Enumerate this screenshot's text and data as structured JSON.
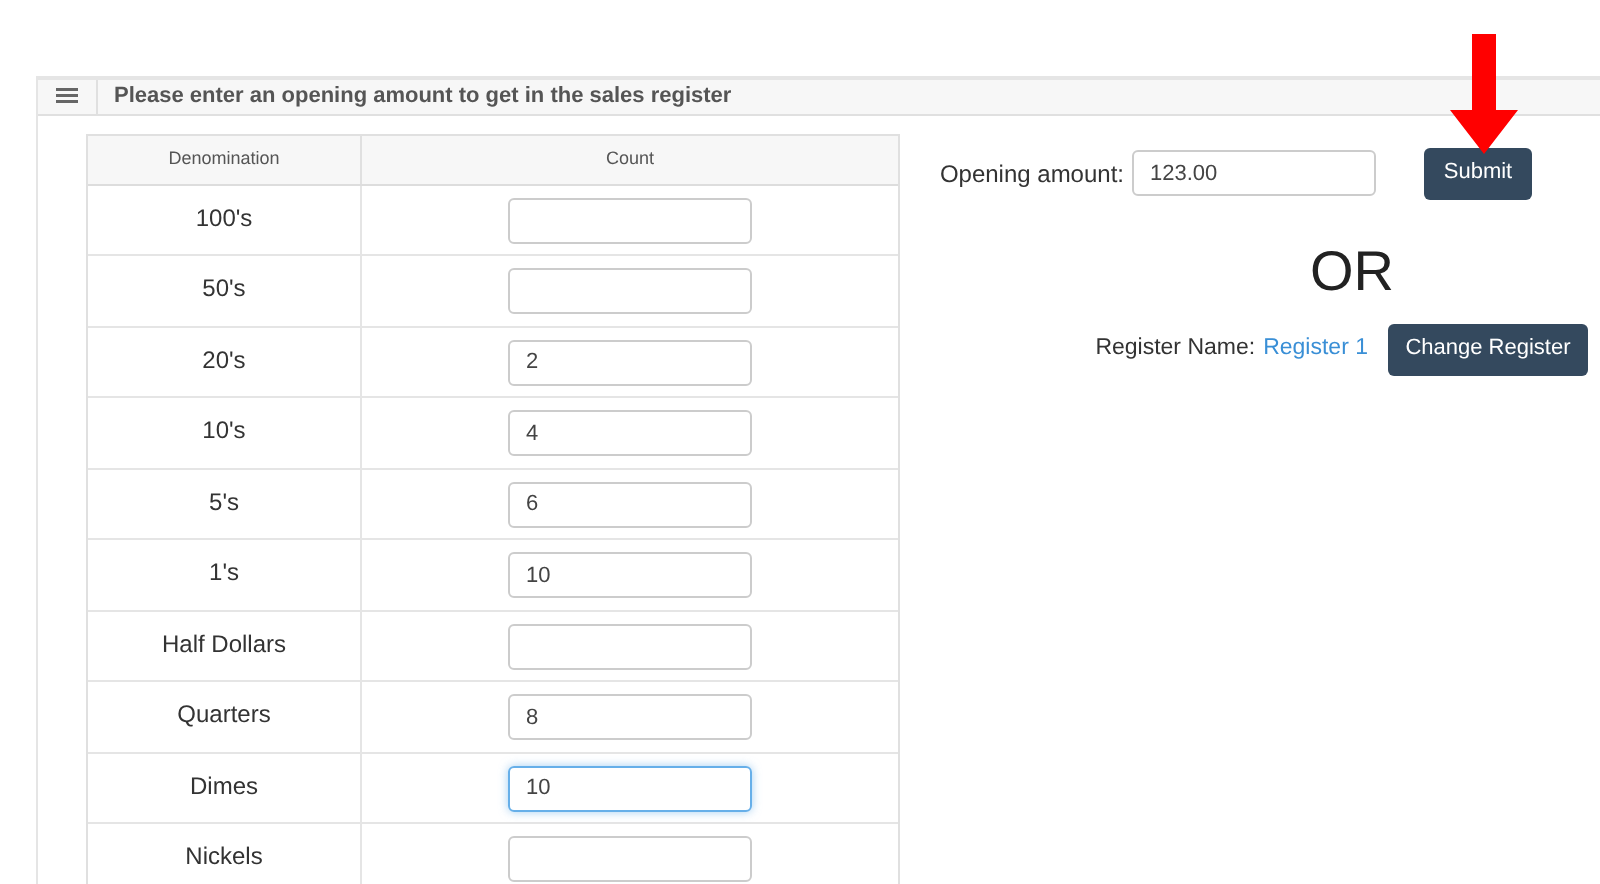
{
  "header": {
    "title": "Please enter an opening amount to get in the sales register"
  },
  "table": {
    "columns": [
      "Denomination",
      "Count"
    ],
    "rows": [
      {
        "denomination": "100's",
        "count": "",
        "focused": false
      },
      {
        "denomination": "50's",
        "count": "",
        "focused": false
      },
      {
        "denomination": "20's",
        "count": "2",
        "focused": false
      },
      {
        "denomination": "10's",
        "count": "4",
        "focused": false
      },
      {
        "denomination": "5's",
        "count": "6",
        "focused": false
      },
      {
        "denomination": "1's",
        "count": "10",
        "focused": false
      },
      {
        "denomination": "Half Dollars",
        "count": "",
        "focused": false
      },
      {
        "denomination": "Quarters",
        "count": "8",
        "focused": false
      },
      {
        "denomination": "Dimes",
        "count": "10",
        "focused": true
      },
      {
        "denomination": "Nickels",
        "count": "",
        "focused": false
      }
    ]
  },
  "opening": {
    "label": "Opening amount:",
    "value": "123.00",
    "submit": "Submit"
  },
  "separator": "OR",
  "register": {
    "label": "Register Name:",
    "name": "Register 1",
    "button": "Change Register"
  }
}
